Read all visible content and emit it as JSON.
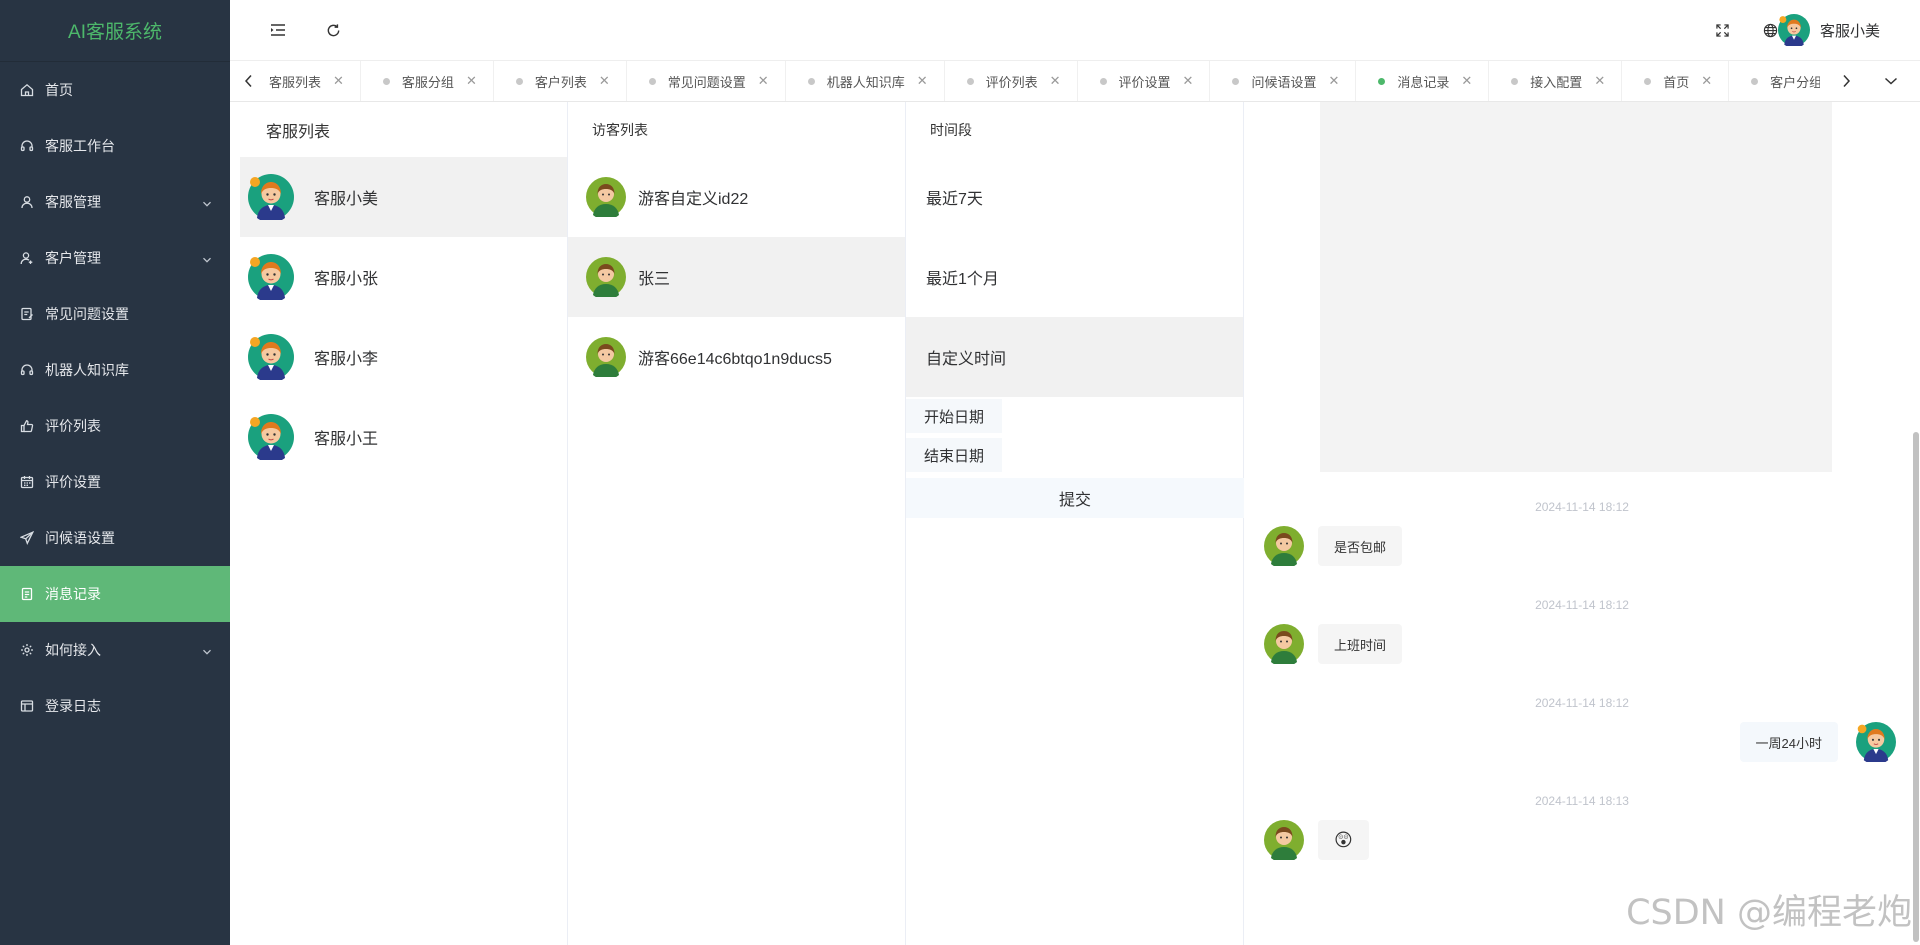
{
  "app": {
    "title": "AI客服系统"
  },
  "sidebar": {
    "items": [
      {
        "label": "首页",
        "icon": "home-icon"
      },
      {
        "label": "客服工作台",
        "icon": "headset-icon"
      },
      {
        "label": "客服管理",
        "icon": "user-icon",
        "expandable": true
      },
      {
        "label": "客户管理",
        "icon": "users-icon",
        "expandable": true
      },
      {
        "label": "常见问题设置",
        "icon": "faq-icon"
      },
      {
        "label": "机器人知识库",
        "icon": "robot-icon"
      },
      {
        "label": "评价列表",
        "icon": "thumb-icon"
      },
      {
        "label": "评价设置",
        "icon": "calendar-icon"
      },
      {
        "label": "问候语设置",
        "icon": "send-icon"
      },
      {
        "label": "消息记录",
        "icon": "document-icon",
        "active": true
      },
      {
        "label": "如何接入",
        "icon": "gear-icon",
        "expandable": true
      },
      {
        "label": "登录日志",
        "icon": "log-icon"
      }
    ]
  },
  "header": {
    "user_name": "客服小美"
  },
  "tabs": [
    {
      "label": "客服列表"
    },
    {
      "label": "客服分组"
    },
    {
      "label": "客户列表"
    },
    {
      "label": "常见问题设置"
    },
    {
      "label": "机器人知识库"
    },
    {
      "label": "评价列表"
    },
    {
      "label": "评价设置"
    },
    {
      "label": "问候语设置"
    },
    {
      "label": "消息记录",
      "active": true
    },
    {
      "label": "接入配置"
    },
    {
      "label": "首页"
    },
    {
      "label": "客户分组"
    }
  ],
  "agents": {
    "title": "客服列表",
    "items": [
      "客服小美",
      "客服小张",
      "客服小李",
      "客服小王"
    ]
  },
  "visitors": {
    "title": "访客列表",
    "items": [
      "游客自定义id22",
      "张三",
      "游客66e14c6btqo1n9ducs5"
    ]
  },
  "periods": {
    "title": "时间段",
    "options": [
      "最近7天",
      "最近1个月",
      "自定义时间"
    ],
    "start_label": "开始日期",
    "end_label": "结束日期",
    "submit_label": "提交"
  },
  "chat": {
    "messages": [
      {
        "time": "2024-11-14 18:12",
        "side": "left",
        "text": "是否包邮"
      },
      {
        "time": "2024-11-14 18:12",
        "side": "left",
        "text": "上班时间"
      },
      {
        "time": "2024-11-14 18:12",
        "side": "right",
        "text": "一周24小时"
      },
      {
        "time": "2024-11-14 18:13",
        "side": "left",
        "text": "😲"
      }
    ]
  },
  "watermark": "CSDN @编程老炮",
  "colors": {
    "sidebar_bg": "#283443",
    "accent": "#5fb878",
    "logo": "#4db86b"
  }
}
